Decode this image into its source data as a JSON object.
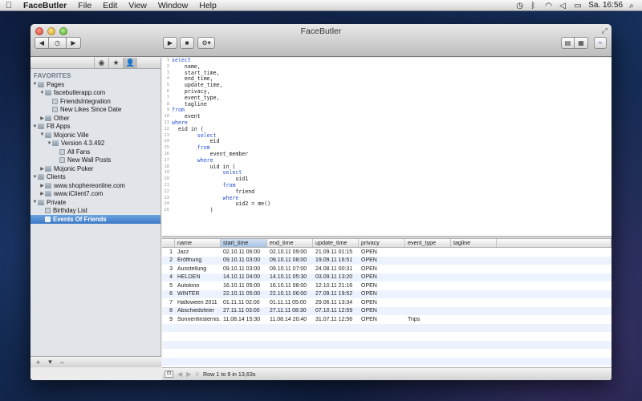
{
  "menubar": {
    "apple": "",
    "app_name": "FaceButler",
    "items": [
      "File",
      "Edit",
      "View",
      "Window",
      "Help"
    ],
    "clock": "Sa. 16:56"
  },
  "window": {
    "title": "FaceButler"
  },
  "toolbar": {
    "back_icon": "◀",
    "history_icon": "◷",
    "forward_icon": "▶",
    "run_icon": "▶",
    "stop_icon": "■",
    "action_icon": "⚙▾",
    "layout1_icon": "▤",
    "layout2_icon": "▦",
    "activity_icon": "~"
  },
  "sidebar": {
    "tabs": [
      "◉",
      "★",
      "👤"
    ],
    "section": "FAVORITES",
    "tree": [
      {
        "label": "Pages",
        "level": 0,
        "disc": "▼",
        "icon": "folder"
      },
      {
        "label": "facebutlerapp.com",
        "level": 1,
        "disc": "▼",
        "icon": "folder"
      },
      {
        "label": "FriendsIntegration",
        "level": 2,
        "disc": "",
        "icon": "doc"
      },
      {
        "label": "New Likes Since Date",
        "level": 2,
        "disc": "",
        "icon": "doc"
      },
      {
        "label": "Other",
        "level": 1,
        "disc": "▶",
        "icon": "folder"
      },
      {
        "label": "FB Apps",
        "level": 0,
        "disc": "▼",
        "icon": "folder"
      },
      {
        "label": "Mojonic Ville",
        "level": 1,
        "disc": "▼",
        "icon": "folder"
      },
      {
        "label": "Version 4.3.492",
        "level": 2,
        "disc": "▼",
        "icon": "folder"
      },
      {
        "label": "All Fans",
        "level": 3,
        "disc": "",
        "icon": "doc"
      },
      {
        "label": "New Wall Posts",
        "level": 3,
        "disc": "",
        "icon": "doc"
      },
      {
        "label": "Mojonic Poker",
        "level": 1,
        "disc": "▶",
        "icon": "folder"
      },
      {
        "label": "Clients",
        "level": 0,
        "disc": "▼",
        "icon": "folder"
      },
      {
        "label": "www.shophereonline.com",
        "level": 1,
        "disc": "▶",
        "icon": "folder"
      },
      {
        "label": "www.iClient7.com",
        "level": 1,
        "disc": "▶",
        "icon": "folder"
      },
      {
        "label": "Private",
        "level": 0,
        "disc": "▼",
        "icon": "folder"
      },
      {
        "label": "Birthday List",
        "level": 1,
        "disc": "",
        "icon": "doc"
      },
      {
        "label": "Events Of Friends",
        "level": 1,
        "disc": "",
        "icon": "doc",
        "selected": true
      }
    ],
    "footer": [
      "+",
      "▾",
      "−"
    ]
  },
  "editor": {
    "lines": [
      {
        "n": "1",
        "indent": "",
        "kw": "select",
        "text": ""
      },
      {
        "n": "2",
        "indent": "    ",
        "kw": "",
        "text": "name,"
      },
      {
        "n": "3",
        "indent": "    ",
        "kw": "",
        "text": "start_time,"
      },
      {
        "n": "4",
        "indent": "    ",
        "kw": "",
        "text": "end_time,"
      },
      {
        "n": "5",
        "indent": "    ",
        "kw": "",
        "text": "update_time,"
      },
      {
        "n": "6",
        "indent": "    ",
        "kw": "",
        "text": "privacy,"
      },
      {
        "n": "7",
        "indent": "    ",
        "kw": "",
        "text": "event_type,"
      },
      {
        "n": "8",
        "indent": "    ",
        "kw": "",
        "text": "tagline"
      },
      {
        "n": "9",
        "indent": "",
        "kw": "from",
        "text": ""
      },
      {
        "n": "10",
        "indent": "    ",
        "kw": "",
        "text": "event"
      },
      {
        "n": "11",
        "indent": "",
        "kw": "where",
        "text": ""
      },
      {
        "n": "12",
        "indent": "  ",
        "kw": "",
        "text": "eid in ("
      },
      {
        "n": "13",
        "indent": "        ",
        "kw": "select",
        "text": ""
      },
      {
        "n": "14",
        "indent": "            ",
        "kw": "",
        "text": "eid"
      },
      {
        "n": "15",
        "indent": "        ",
        "kw": "from",
        "text": ""
      },
      {
        "n": "16",
        "indent": "            ",
        "kw": "",
        "text": "event_member"
      },
      {
        "n": "17",
        "indent": "        ",
        "kw": "where",
        "text": ""
      },
      {
        "n": "18",
        "indent": "            ",
        "kw": "",
        "text": "uid in ("
      },
      {
        "n": "19",
        "indent": "                ",
        "kw": "select",
        "text": ""
      },
      {
        "n": "20",
        "indent": "                    ",
        "kw": "",
        "text": "uid1"
      },
      {
        "n": "21",
        "indent": "                ",
        "kw": "from",
        "text": ""
      },
      {
        "n": "22",
        "indent": "                    ",
        "kw": "",
        "text": "friend"
      },
      {
        "n": "23",
        "indent": "                ",
        "kw": "where",
        "text": ""
      },
      {
        "n": "24",
        "indent": "                    ",
        "kw": "",
        "text": "uid2 = me()"
      },
      {
        "n": "25",
        "indent": "            ",
        "kw": "",
        "text": ")"
      }
    ]
  },
  "results": {
    "columns": [
      "",
      "name",
      "start_time",
      "end_time",
      "update_time",
      "privacy",
      "event_type",
      "tagline"
    ],
    "sorted_column": 2,
    "rows": [
      [
        "1",
        "Jazz",
        "02.10.11 06:00",
        "02.10.11 09:00",
        "21.09.11 01:15",
        "OPEN",
        "",
        ""
      ],
      [
        "2",
        "Eröffnung",
        "09.10.11 03:00",
        "09.10.11 08:00",
        "19.09.11 16:51",
        "OPEN",
        "",
        ""
      ],
      [
        "3",
        "Ausstellung",
        "09.10.11 03:00",
        "09.10.11 07:00",
        "24.08.11 00:31",
        "OPEN",
        "",
        ""
      ],
      [
        "4",
        "HELDEN",
        "14.10.11 04:00",
        "14.10.11 05:30",
        "03.09.11 13:20",
        "OPEN",
        "",
        ""
      ],
      [
        "5",
        "Autokino",
        "16.10.11 05:00",
        "16.10.11 08:00",
        "12.10.11 21:16",
        "OPEN",
        "",
        ""
      ],
      [
        "6",
        "WINTER",
        "22.10.11 05:00",
        "22.10.11 06:00",
        "27.09.11 19:52",
        "OPEN",
        "",
        ""
      ],
      [
        "7",
        "Halloween 2011",
        "01.11.11 02:00",
        "01.11.11 05:00",
        "29.06.11 13:34",
        "OPEN",
        "",
        ""
      ],
      [
        "8",
        "Abschiedsfeier",
        "27.11.11 03:00",
        "27.11.11 08:30",
        "07.10.11 12:59",
        "OPEN",
        "",
        ""
      ],
      [
        "9",
        "Sonnenfinsternis...",
        "11.08.14 15:30",
        "11.08.14 20:40",
        "31.07.11 12:56",
        "OPEN",
        "Trips",
        ""
      ]
    ],
    "empty_rows": 8
  },
  "status": {
    "text": "Row 1 to 9 in 13,63s"
  },
  "colors": {
    "selection": "#3d78c6",
    "keyword": "#2850d8",
    "zebra": "#edf3fe"
  }
}
